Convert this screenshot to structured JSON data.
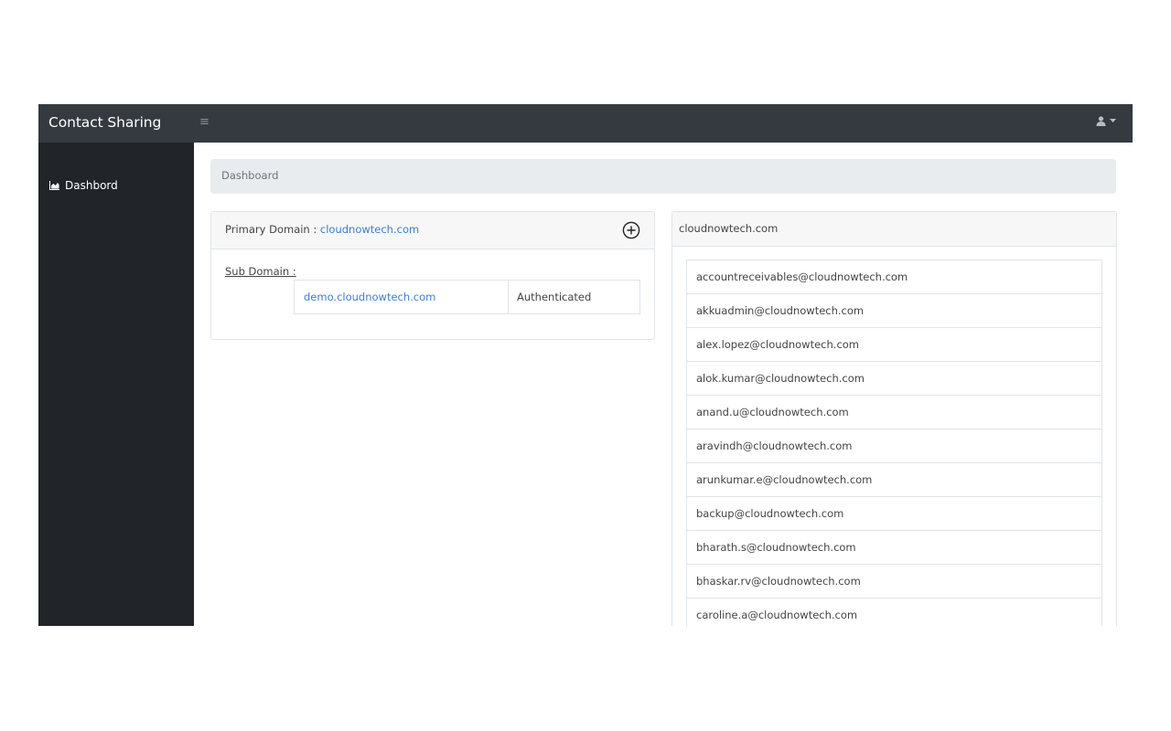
{
  "navbar": {
    "brand": "Contact Sharing",
    "menu_icon": "hamburger-icon",
    "user_icon": "user-icon",
    "caret_icon": "caret-down-icon"
  },
  "sidebar": {
    "items": [
      {
        "label": "Dashbord",
        "icon": "area-chart-icon"
      }
    ]
  },
  "breadcrumb": {
    "title": "Dashboard"
  },
  "primary_card": {
    "label": "Primary Domain : ",
    "domain": "cloudnowtech.com",
    "add_icon": "plus-circle-icon",
    "subdomain_label": "Sub Domain :",
    "subdomains": [
      {
        "name": "demo.cloudnowtech.com",
        "status": "Authenticated"
      }
    ]
  },
  "domain_card": {
    "title": "cloudnowtech.com",
    "emails": [
      "accountreceivables@cloudnowtech.com",
      "akkuadmin@cloudnowtech.com",
      "alex.lopez@cloudnowtech.com",
      "alok.kumar@cloudnowtech.com",
      "anand.u@cloudnowtech.com",
      "aravindh@cloudnowtech.com",
      "arunkumar.e@cloudnowtech.com",
      "backup@cloudnowtech.com",
      "bharath.s@cloudnowtech.com",
      "bhaskar.rv@cloudnowtech.com",
      "caroline.a@cloudnowtech.com"
    ]
  },
  "colors": {
    "navbar": "#343a40",
    "sidebar": "#212529",
    "link": "#3b7ddd",
    "breadcrumb_bg": "#e9ecef"
  }
}
